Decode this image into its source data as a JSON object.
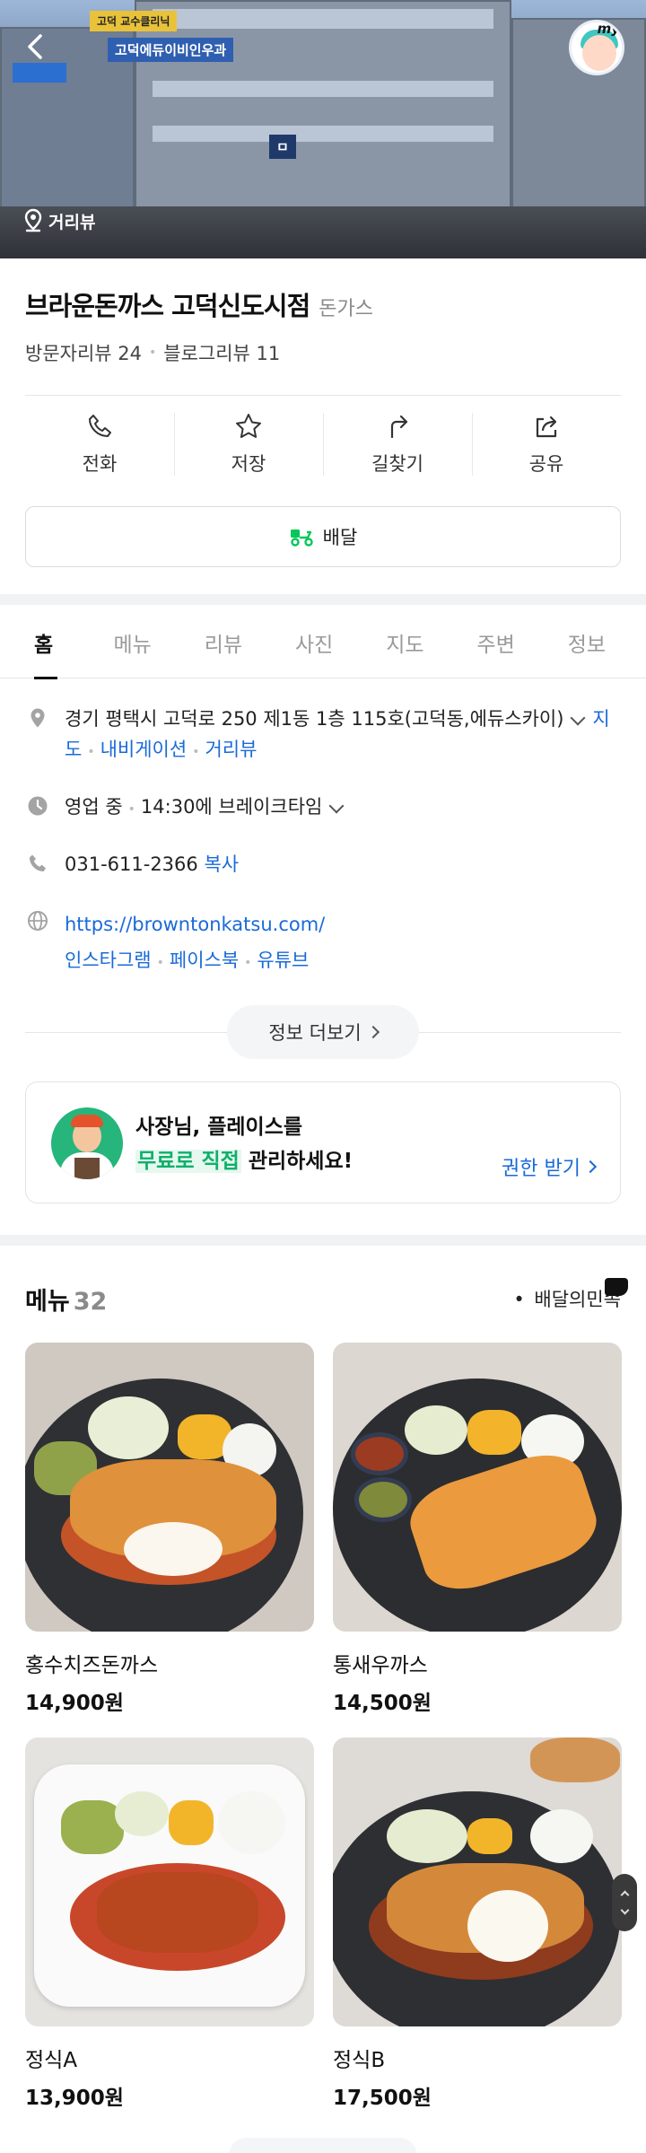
{
  "hero": {
    "streetview_label": "거리뷰",
    "my_badge": "my",
    "signs": [
      "고덕에듀이비인우과",
      "고덕 교수클리닉",
      "ㅁ"
    ]
  },
  "place": {
    "name": "브라운돈까스 고덕신도시점",
    "category": "돈가스",
    "visitor_reviews": "방문자리뷰 24",
    "blog_reviews": "블로그리뷰 11"
  },
  "actions": [
    {
      "label": "전화",
      "icon": "phone-icon"
    },
    {
      "label": "저장",
      "icon": "star-icon"
    },
    {
      "label": "길찾기",
      "icon": "directions-icon"
    },
    {
      "label": "공유",
      "icon": "share-icon"
    }
  ],
  "delivery": {
    "label": "배달",
    "icon": "delivery-scooter-icon",
    "icon_color": "#03c75a"
  },
  "tabs": [
    "홈",
    "메뉴",
    "리뷰",
    "사진",
    "지도",
    "주변",
    "정보"
  ],
  "info": {
    "address": "경기 평택시 고덕로 250 제1동 1층 115호(고덕동,에듀스카이)",
    "address_links": [
      "지도",
      "내비게이션",
      "거리뷰"
    ],
    "hours_status": "영업 중",
    "hours_detail": "14:30에 브레이크타임",
    "phone": "031-611-2366",
    "copy_label": "복사",
    "website": "https://browntonkatsu.com/",
    "social_links": [
      "인스타그램",
      "페이스북",
      "유튜브"
    ],
    "more_label": "정보 더보기"
  },
  "owner_banner": {
    "line1": "사장님, 플레이스를",
    "line2_highlight": "무료로 직접",
    "line2_rest": " 관리하세요!",
    "claim_label": "권한 받기",
    "highlight_color": "#0eaf6b"
  },
  "menu": {
    "title": "메뉴",
    "count": "32",
    "source": "배달의민족",
    "items": [
      {
        "name": "홍수치즈돈까스",
        "price": "14,900원"
      },
      {
        "name": "통새우까스",
        "price": "14,500원"
      },
      {
        "name": "정식A",
        "price": "13,900원"
      },
      {
        "name": "정식B",
        "price": "17,500원"
      }
    ]
  },
  "colors": {
    "link": "#1a6ad8",
    "active_tab": "#111111",
    "inactive_tab": "#9a9a9a"
  }
}
